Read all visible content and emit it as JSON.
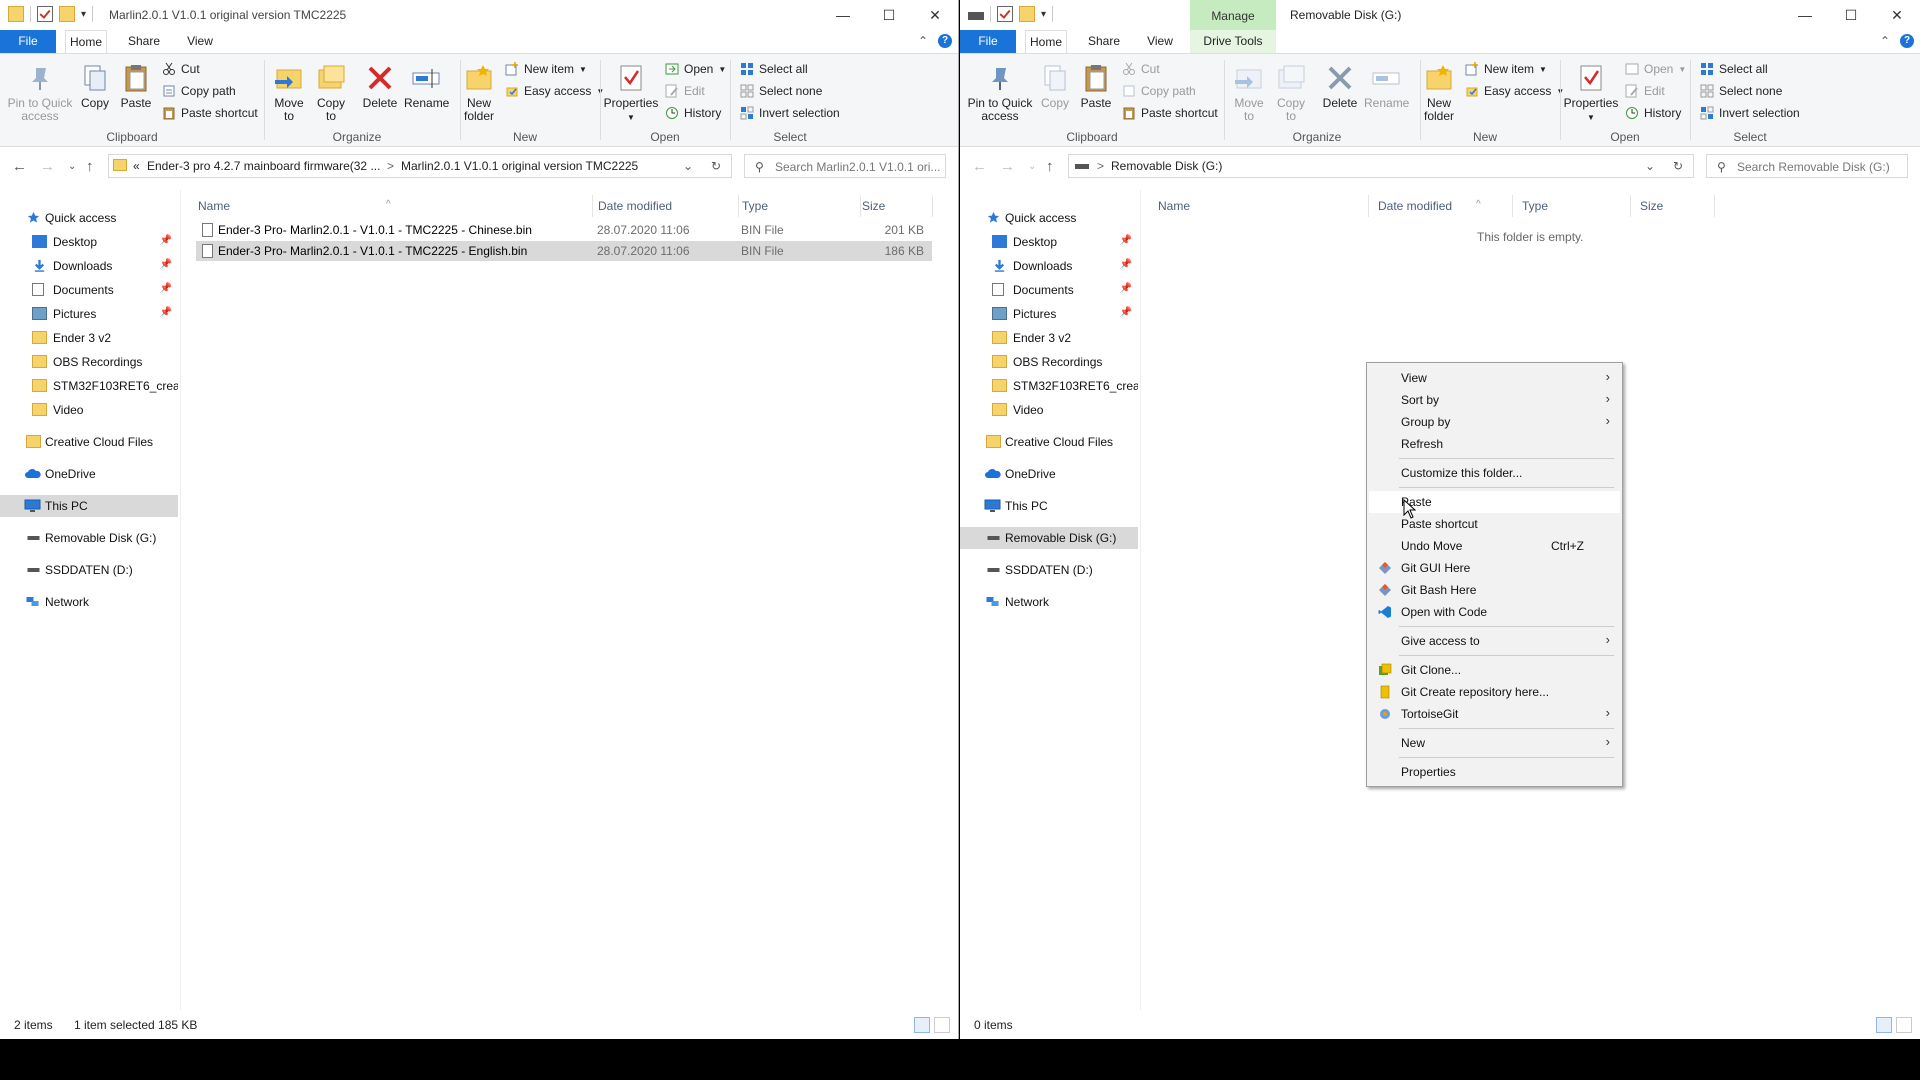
{
  "left": {
    "title": "Marlin2.0.1  V1.0.1 original version TMC2225",
    "tabs": {
      "file": "File",
      "home": "Home",
      "share": "Share",
      "view": "View"
    },
    "ribbon": {
      "pin": "Pin to Quick access",
      "copy": "Copy",
      "paste": "Paste",
      "cut": "Cut",
      "copy_path": "Copy path",
      "paste_shortcut": "Paste shortcut",
      "clipboard": "Clipboard",
      "move_to": "Move to",
      "copy_to": "Copy to",
      "delete": "Delete",
      "rename": "Rename",
      "organize": "Organize",
      "new_folder": "New folder",
      "new_item": "New item",
      "easy_access": "Easy access",
      "new": "New",
      "properties": "Properties",
      "open_btn": "Open",
      "edit": "Edit",
      "history": "History",
      "open": "Open",
      "select_all": "Select all",
      "select_none": "Select none",
      "invert_selection": "Invert selection",
      "select": "Select"
    },
    "address": {
      "prefix": "«",
      "crumb1": "Ender-3 pro 4.2.7 mainboard firmware(32 ...",
      "sep": ">",
      "crumb2": "Marlin2.0.1  V1.0.1 original version TMC2225"
    },
    "search_placeholder": "Search Marlin2.0.1  V1.0.1 ori...",
    "columns": {
      "name": "Name",
      "date": "Date modified",
      "type": "Type",
      "size": "Size"
    },
    "files": [
      {
        "name": "Ender-3 Pro- Marlin2.0.1 - V1.0.1 - TMC2225 - Chinese.bin",
        "date": "28.07.2020 11:06",
        "type": "BIN File",
        "size": "201 KB"
      },
      {
        "name": "Ender-3 Pro- Marlin2.0.1 - V1.0.1 - TMC2225 - English.bin",
        "date": "28.07.2020 11:06",
        "type": "BIN File",
        "size": "186 KB"
      }
    ],
    "status": {
      "items": "2 items",
      "selected": "1 item selected  185 KB"
    }
  },
  "right": {
    "manage": "Manage",
    "title": "Removable Disk (G:)",
    "tabs": {
      "file": "File",
      "home": "Home",
      "share": "Share",
      "view": "View",
      "drive_tools": "Drive Tools"
    },
    "address": {
      "sep": ">",
      "crumb1": "Removable Disk (G:)"
    },
    "search_placeholder": "Search Removable Disk (G:)",
    "columns": {
      "name": "Name",
      "date": "Date modified",
      "type": "Type",
      "size": "Size"
    },
    "empty": "This folder is empty.",
    "status": {
      "items": "0 items"
    }
  },
  "nav": {
    "quick_access": "Quick access",
    "desktop": "Desktop",
    "downloads": "Downloads",
    "documents": "Documents",
    "pictures": "Pictures",
    "ender": "Ender 3 v2",
    "obs": "OBS Recordings",
    "stm": "STM32F103RET6_creality",
    "video": "Video",
    "creative": "Creative Cloud Files",
    "onedrive": "OneDrive",
    "thispc": "This PC",
    "removable": "Removable Disk (G:)",
    "ssd": "SSDDATEN (D:)",
    "network": "Network"
  },
  "context_menu": {
    "view": "View",
    "sort_by": "Sort by",
    "group_by": "Group by",
    "refresh": "Refresh",
    "customize": "Customize this folder...",
    "paste": "Paste",
    "paste_shortcut": "Paste shortcut",
    "undo_move": "Undo Move",
    "undo_shortcut": "Ctrl+Z",
    "git_gui": "Git GUI Here",
    "git_bash": "Git Bash Here",
    "open_code": "Open with Code",
    "give_access": "Give access to",
    "git_clone": "Git Clone...",
    "git_create": "Git Create repository here...",
    "tortoise": "TortoiseGit",
    "new": "New",
    "properties": "Properties"
  },
  "icons": {
    "minimize": "—",
    "maximize": "☐",
    "close": "✕",
    "up_chev": "⌃",
    "help": "?",
    "back": "←",
    "forward": "→",
    "up": "↑",
    "refresh": "↻",
    "search": "⚲",
    "submenu": "›",
    "dropdown": "⌄"
  }
}
